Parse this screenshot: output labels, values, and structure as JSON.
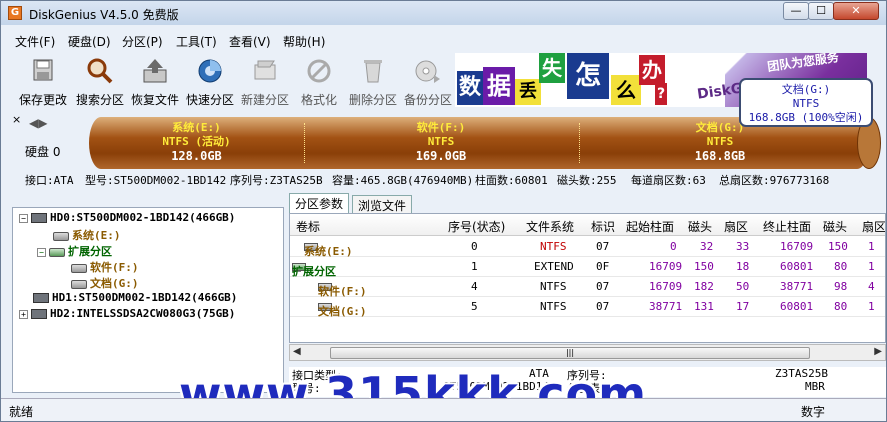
{
  "window": {
    "title": "DiskGenius V4.5.0 免费版",
    "app_icon": "G"
  },
  "menu": [
    "文件(F)",
    "硬盘(D)",
    "分区(P)",
    "工具(T)",
    "查看(V)",
    "帮助(H)"
  ],
  "toolbar": [
    {
      "label": "保存更改",
      "icon": "save-icon"
    },
    {
      "label": "搜索分区",
      "icon": "search-partition-icon"
    },
    {
      "label": "恢复文件",
      "icon": "recover-files-icon"
    },
    {
      "label": "快速分区",
      "icon": "quick-partition-icon"
    },
    {
      "label": "新建分区",
      "icon": "new-partition-icon"
    },
    {
      "label": "格式化",
      "icon": "format-icon"
    },
    {
      "label": "删除分区",
      "icon": "delete-partition-icon"
    },
    {
      "label": "备份分区",
      "icon": "backup-partition-icon"
    }
  ],
  "banner": {
    "chars": [
      "数",
      "据",
      "丢",
      "失",
      "怎",
      "么",
      "办"
    ],
    "qmark": "?",
    "slogan": "团队为您服务",
    "brand": "DiskGe"
  },
  "tooltip": {
    "name": "文档(G:)",
    "fs": "NTFS",
    "size": "168.8GB (100%空闲)"
  },
  "diskmap": {
    "disk_label": "硬盘 0",
    "partitions": [
      {
        "name": "系统(E:)",
        "fs": "NTFS (活动)",
        "size": "128.0GB"
      },
      {
        "name": "软件(F:)",
        "fs": "NTFS",
        "size": "169.0GB"
      },
      {
        "name": "文档(G:)",
        "fs": "NTFS",
        "size": "168.8GB"
      }
    ]
  },
  "infobar": {
    "iface": "接口:ATA",
    "model": "型号:ST500DM002-1BD142",
    "serial": "序列号:Z3TAS25B",
    "capacity": "容量:465.8GB(476940MB)",
    "cylinders": "柱面数:60801",
    "heads": "磁头数:255",
    "sectors_per_track": "每道扇区数:63",
    "total_sectors": "总扇区数:976773168"
  },
  "tree": [
    {
      "label": "HD0:ST500DM002-1BD142(466GB)",
      "type": "disk",
      "color": "#000000"
    },
    {
      "label": "系统(E:)",
      "type": "vol",
      "color": "#8a5a00"
    },
    {
      "label": "扩展分区",
      "type": "ext",
      "color": "#006400"
    },
    {
      "label": "软件(F:)",
      "type": "vol",
      "color": "#8a5a00"
    },
    {
      "label": "文档(G:)",
      "type": "vol",
      "color": "#8a5a00"
    },
    {
      "label": "HD1:ST500DM002-1BD142(466GB)",
      "type": "disk",
      "color": "#000000"
    },
    {
      "label": "HD2:INTELSSDSA2CW080G3(75GB)",
      "type": "disk",
      "color": "#000000"
    }
  ],
  "tabs": [
    "分区参数",
    "浏览文件"
  ],
  "table": {
    "headers": [
      "卷标",
      "序号(状态)",
      "文件系统",
      "标识",
      "起始柱面",
      "磁头",
      "扇区",
      "终止柱面",
      "磁头",
      "扇区"
    ],
    "rows": [
      {
        "label": "系统(E:)",
        "seq": "0",
        "fs": "NTFS",
        "id": "07",
        "start_cyl": "0",
        "head": "32",
        "sector": "33",
        "end_cyl": "16709",
        "end_head": "150",
        "end_sector": "1"
      },
      {
        "label": "扩展分区",
        "seq": "1",
        "fs": "EXTEND",
        "id": "0F",
        "start_cyl": "16709",
        "head": "150",
        "sector": "18",
        "end_cyl": "60801",
        "end_head": "80",
        "end_sector": "1"
      },
      {
        "label": "软件(F:)",
        "seq": "4",
        "fs": "NTFS",
        "id": "07",
        "start_cyl": "16709",
        "head": "182",
        "sector": "50",
        "end_cyl": "38771",
        "end_head": "98",
        "end_sector": "4"
      },
      {
        "label": "文档(G:)",
        "seq": "5",
        "fs": "NTFS",
        "id": "07",
        "start_cyl": "38771",
        "head": "131",
        "sector": "17",
        "end_cyl": "60801",
        "end_head": "80",
        "end_sector": "1"
      }
    ]
  },
  "details": {
    "iface_label": "接口类型:",
    "iface_value": "ATA",
    "serial_label": "序列号:",
    "serial_value": "Z3TAS25B",
    "model_label": "型号:",
    "model_value": "ST500DM002-1BD142",
    "table_type_label": "分区表类型:",
    "table_type_value": "MBR"
  },
  "status": {
    "left": "就绪",
    "right": "数字"
  },
  "watermark": "www.315kkk.com",
  "colors": {
    "fs_ntfs": "#c00000",
    "cyl_numbers": "#8000a0",
    "tree_ext": "#006400"
  }
}
